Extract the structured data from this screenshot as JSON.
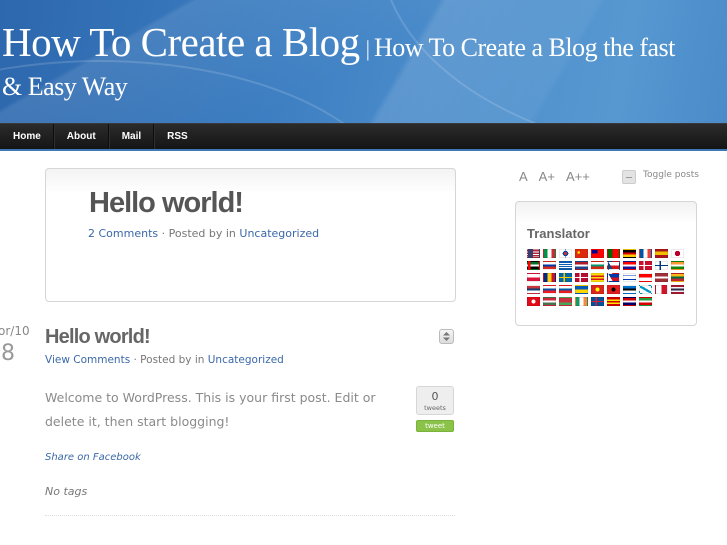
{
  "header": {
    "site_title": "How To Create a Blog",
    "separator": "|",
    "tagline_part1": "How To Create a Blog the fast",
    "tagline_part2": "& Easy Way"
  },
  "nav": {
    "items": [
      {
        "label": "Home"
      },
      {
        "label": "About"
      },
      {
        "label": "Mail"
      },
      {
        "label": "RSS"
      }
    ]
  },
  "featured": {
    "title": "Hello world!",
    "comments_link": "2 Comments",
    "meta_middle": " · Posted by in ",
    "category": "Uncategorized"
  },
  "post": {
    "date_month": "or/10",
    "date_day": "8",
    "title": "Hello world!",
    "comments_link": "View Comments",
    "meta_middle": " · Posted by in ",
    "category": "Uncategorized",
    "body": "Welcome to WordPress. This is your first post. Edit or delete it, then start blogging!",
    "tweet_count": "0",
    "tweet_count_label": "tweets",
    "tweet_button": "tweet",
    "share_facebook": "Share on Facebook",
    "tags": "No tags",
    "toggle_icon": "up-down-arrows-icon"
  },
  "sidebar": {
    "font_sizes": [
      "A",
      "A+",
      "A++"
    ],
    "toggle_posts_label": "Toggle posts",
    "translator": {
      "title": "Translator",
      "flags": [
        {
          "lang": "English (US)",
          "colors": [
            "#b22234",
            "#ffffff",
            "#3c3b6e"
          ],
          "style": "us"
        },
        {
          "lang": "Italian",
          "colors": [
            "#009246",
            "#ffffff",
            "#ce2b37"
          ],
          "style": "v3"
        },
        {
          "lang": "Korean",
          "colors": [
            "#ffffff",
            "#cd2e3a",
            "#0047a0"
          ],
          "style": "kr"
        },
        {
          "lang": "Chinese",
          "colors": [
            "#de2910",
            "#ffde00"
          ],
          "style": "cn"
        },
        {
          "lang": "Chinese (Traditional)",
          "colors": [
            "#fe0000",
            "#000095"
          ],
          "style": "tw"
        },
        {
          "lang": "Portuguese",
          "colors": [
            "#006600",
            "#ff0000"
          ],
          "style": "pt"
        },
        {
          "lang": "German",
          "colors": [
            "#000000",
            "#dd0000",
            "#ffce00"
          ],
          "style": "h3"
        },
        {
          "lang": "French",
          "colors": [
            "#0055a4",
            "#ffffff",
            "#ef4135"
          ],
          "style": "v3"
        },
        {
          "lang": "Spanish",
          "colors": [
            "#aa151b",
            "#f1bf00",
            "#aa151b"
          ],
          "style": "es"
        },
        {
          "lang": "Japanese",
          "colors": [
            "#ffffff",
            "#bc002d"
          ],
          "style": "jp"
        },
        {
          "lang": "Arabic",
          "colors": [
            "#00732f",
            "#ffffff",
            "#000000",
            "#ff0000"
          ],
          "style": "ae"
        },
        {
          "lang": "Russian",
          "colors": [
            "#ffffff",
            "#0039a6",
            "#d52b1e"
          ],
          "style": "h3"
        },
        {
          "lang": "Greek",
          "colors": [
            "#0d5eaf",
            "#ffffff"
          ],
          "style": "gr"
        },
        {
          "lang": "Dutch",
          "colors": [
            "#ae1c28",
            "#ffffff",
            "#21468b"
          ],
          "style": "h3"
        },
        {
          "lang": "Bulgarian",
          "colors": [
            "#ffffff",
            "#00966e",
            "#d62612"
          ],
          "style": "h3"
        },
        {
          "lang": "Czech",
          "colors": [
            "#ffffff",
            "#d7141a",
            "#11457e"
          ],
          "style": "cz"
        },
        {
          "lang": "Croatian",
          "colors": [
            "#ff0000",
            "#ffffff",
            "#171796"
          ],
          "style": "h3"
        },
        {
          "lang": "Danish",
          "colors": [
            "#c8102e",
            "#ffffff"
          ],
          "style": "nordic"
        },
        {
          "lang": "Finnish",
          "colors": [
            "#ffffff",
            "#003580"
          ],
          "style": "nordic"
        },
        {
          "lang": "Hindi",
          "colors": [
            "#ff9933",
            "#ffffff",
            "#138808"
          ],
          "style": "h3"
        },
        {
          "lang": "Polish",
          "colors": [
            "#ffffff",
            "#dc143c"
          ],
          "style": "h2"
        },
        {
          "lang": "Romanian",
          "colors": [
            "#002b7f",
            "#fcd116",
            "#ce1126"
          ],
          "style": "v3"
        },
        {
          "lang": "Swedish",
          "colors": [
            "#006aa7",
            "#fecc00"
          ],
          "style": "nordic"
        },
        {
          "lang": "Norwegian",
          "colors": [
            "#ba0c2f",
            "#ffffff",
            "#00205b"
          ],
          "style": "nordic"
        },
        {
          "lang": "Catalan",
          "colors": [
            "#fcdd09",
            "#da121a"
          ],
          "style": "stripes"
        },
        {
          "lang": "Filipino",
          "colors": [
            "#0038a8",
            "#ce1126",
            "#ffffff"
          ],
          "style": "ph"
        },
        {
          "lang": "Hebrew",
          "colors": [
            "#ffffff",
            "#0038b8"
          ],
          "style": "il"
        },
        {
          "lang": "Indonesian",
          "colors": [
            "#ff0000",
            "#ffffff"
          ],
          "style": "h2"
        },
        {
          "lang": "Latvian",
          "colors": [
            "#9e3039",
            "#ffffff",
            "#9e3039"
          ],
          "style": "h3"
        },
        {
          "lang": "Lithuanian",
          "colors": [
            "#fdb913",
            "#006a44",
            "#c1272d"
          ],
          "style": "h3"
        },
        {
          "lang": "Serbian",
          "colors": [
            "#c6363c",
            "#0c4076",
            "#ffffff"
          ],
          "style": "h3"
        },
        {
          "lang": "Slovak",
          "colors": [
            "#ffffff",
            "#0b4ea2",
            "#ee1c25"
          ],
          "style": "h3"
        },
        {
          "lang": "Slovenian",
          "colors": [
            "#ffffff",
            "#005da4",
            "#ed1c24"
          ],
          "style": "h3"
        },
        {
          "lang": "Ukrainian",
          "colors": [
            "#005bbb",
            "#ffd500"
          ],
          "style": "h2"
        },
        {
          "lang": "Vietnamese",
          "colors": [
            "#da251d",
            "#ffff00"
          ],
          "style": "vn"
        },
        {
          "lang": "Albanian",
          "colors": [
            "#e41e20",
            "#000000"
          ],
          "style": "vn"
        },
        {
          "lang": "Estonian",
          "colors": [
            "#0072ce",
            "#000000",
            "#ffffff"
          ],
          "style": "h3"
        },
        {
          "lang": "Galician",
          "colors": [
            "#ffffff",
            "#0099cc"
          ],
          "style": "gl"
        },
        {
          "lang": "Maltese",
          "colors": [
            "#ffffff",
            "#cf142b"
          ],
          "style": "v2"
        },
        {
          "lang": "Thai",
          "colors": [
            "#a51931",
            "#f4f5f8",
            "#2d2a4a",
            "#f4f5f8",
            "#a51931"
          ],
          "style": "h5"
        },
        {
          "lang": "Turkish",
          "colors": [
            "#e30a17",
            "#ffffff"
          ],
          "style": "vn"
        },
        {
          "lang": "Hungarian",
          "colors": [
            "#ce2939",
            "#ffffff",
            "#477050"
          ],
          "style": "h3"
        },
        {
          "lang": "Belarusian",
          "colors": [
            "#c8313e",
            "#4aa657"
          ],
          "style": "by"
        },
        {
          "lang": "Irish",
          "colors": [
            "#169b62",
            "#ffffff",
            "#ff883e"
          ],
          "style": "v3"
        },
        {
          "lang": "Icelandic",
          "colors": [
            "#02529c",
            "#dc1e35"
          ],
          "style": "nordic"
        },
        {
          "lang": "Macedonian",
          "colors": [
            "#d20000",
            "#ffe600"
          ],
          "style": "stripes"
        },
        {
          "lang": "Malay",
          "colors": [
            "#cc0001",
            "#ffffff",
            "#010066"
          ],
          "style": "h3"
        },
        {
          "lang": "Persian",
          "colors": [
            "#239f40",
            "#ffffff",
            "#da0000"
          ],
          "style": "h3"
        }
      ]
    }
  }
}
